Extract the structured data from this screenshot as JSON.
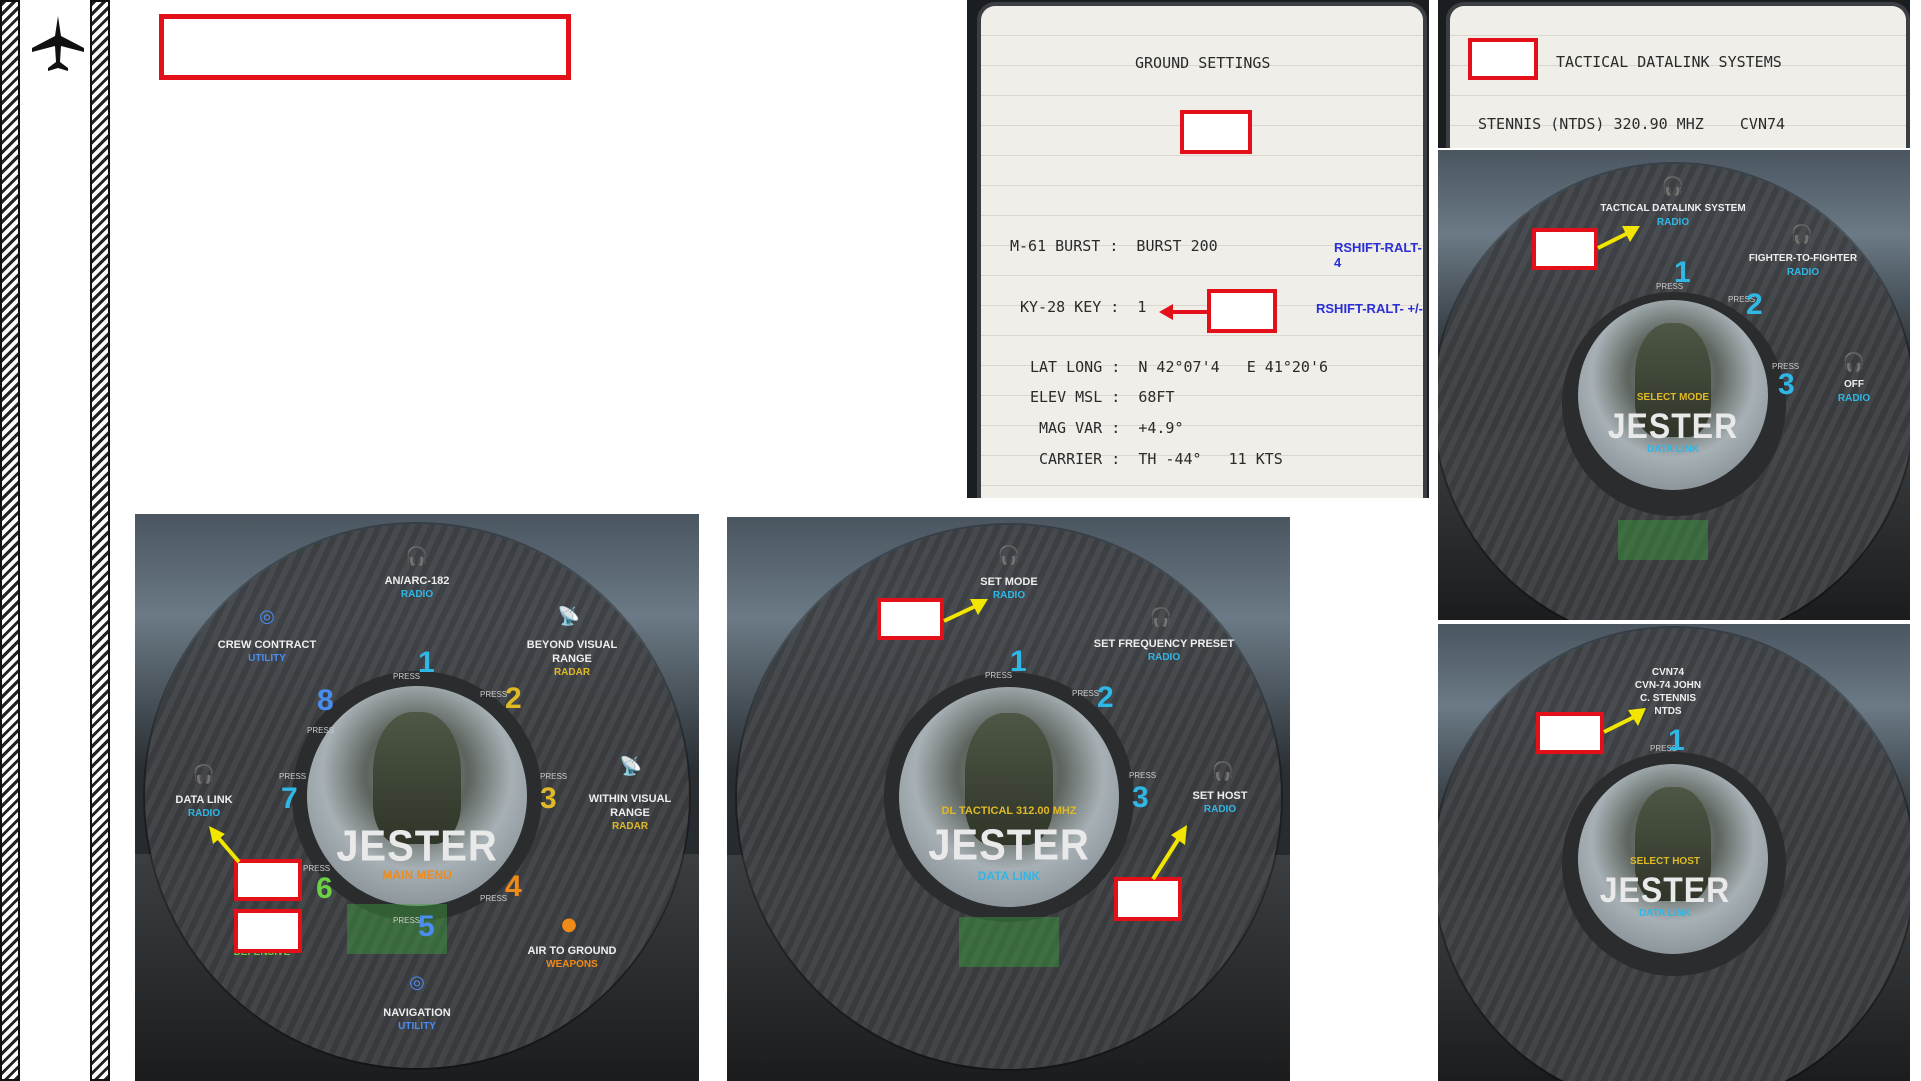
{
  "kneeboard_ground": {
    "title": "GROUND SETTINGS",
    "rows": [
      {
        "label": "M-61 BURST :  BURST 200",
        "hint": "RSHIFT-RALT-4"
      },
      {
        "label": "KY-28 KEY :  1",
        "hint": "RSHIFT-RALT- +/-"
      }
    ],
    "info": [
      "LAT LONG :  N 42°07'4   E 41°20'6",
      "ELEV MSL :  68FT",
      "MAG VAR :  +4.9°",
      "CARRIER :  TH -44°   11 KTS"
    ]
  },
  "kneeboard_datalink": {
    "title": "TACTICAL DATALINK SYSTEMS",
    "row": "STENNIS (NTDS) 320.90 MHZ    CVN74"
  },
  "wheel_main": {
    "title": "JESTER",
    "subtitle": "MAIN MENU",
    "items": [
      {
        "label": "AN/ARC-182",
        "category": "RADIO",
        "num": "1",
        "icon": "headset-icon"
      },
      {
        "label": "BEYOND VISUAL\nRANGE",
        "category": "RADAR",
        "num": "2",
        "icon": "radar-dish-icon"
      },
      {
        "label": "WITHIN VISUAL\nRANGE",
        "category": "RADAR",
        "num": "3",
        "icon": "radar-dish-icon"
      },
      {
        "label": "AIR TO GROUND",
        "category": "WEAPONS",
        "num": "4",
        "icon": "bomb-icon"
      },
      {
        "label": "NAVIGATION",
        "category": "UTILITY",
        "num": "5",
        "icon": "compass-icon"
      },
      {
        "label": "",
        "category": "DEFENSIVE",
        "num": "6",
        "icon": ""
      },
      {
        "label": "DATA LINK",
        "category": "RADIO",
        "num": "7",
        "icon": "headset-icon"
      },
      {
        "label": "CREW CONTRACT",
        "category": "UTILITY",
        "num": "8",
        "icon": "compass-icon"
      }
    ],
    "press": "PRESS"
  },
  "wheel_datalink": {
    "title": "JESTER",
    "subtitle": "DATA LINK",
    "status": "DL TACTICAL 312.00 MHZ",
    "items": [
      {
        "label": "SET MODE",
        "category": "RADIO",
        "num": "1"
      },
      {
        "label": "SET FREQUENCY PRESET",
        "category": "RADIO",
        "num": "2"
      },
      {
        "label": "SET HOST",
        "category": "RADIO",
        "num": "3"
      }
    ],
    "press": "PRESS"
  },
  "wheel_mode": {
    "title": "JESTER",
    "subtitle": "DATA LINK",
    "status": "SELECT MODE",
    "items": [
      {
        "label": "TACTICAL DATALINK SYSTEM",
        "category": "RADIO",
        "num": "1"
      },
      {
        "label": "FIGHTER-TO-FIGHTER",
        "category": "RADIO",
        "num": "2"
      },
      {
        "label": "OFF",
        "category": "RADIO",
        "num": "3"
      }
    ],
    "press": "PRESS"
  },
  "wheel_host": {
    "title": "JESTER",
    "subtitle": "DATA LINK",
    "status": "SELECT HOST",
    "items": [
      {
        "label": "CVN74\nCVN-74 JOHN\nC. STENNIS\nNTDS",
        "category": "",
        "num": "1"
      }
    ],
    "press": "PRESS"
  },
  "colors": {
    "callout_red": "#e3101a",
    "arrow_yellow": "#f2e600",
    "radio_cyan": "#2fb7e6",
    "radar_yellow": "#e0b927",
    "weapons_orange": "#f08a18",
    "defensive_green": "#6cd146"
  }
}
